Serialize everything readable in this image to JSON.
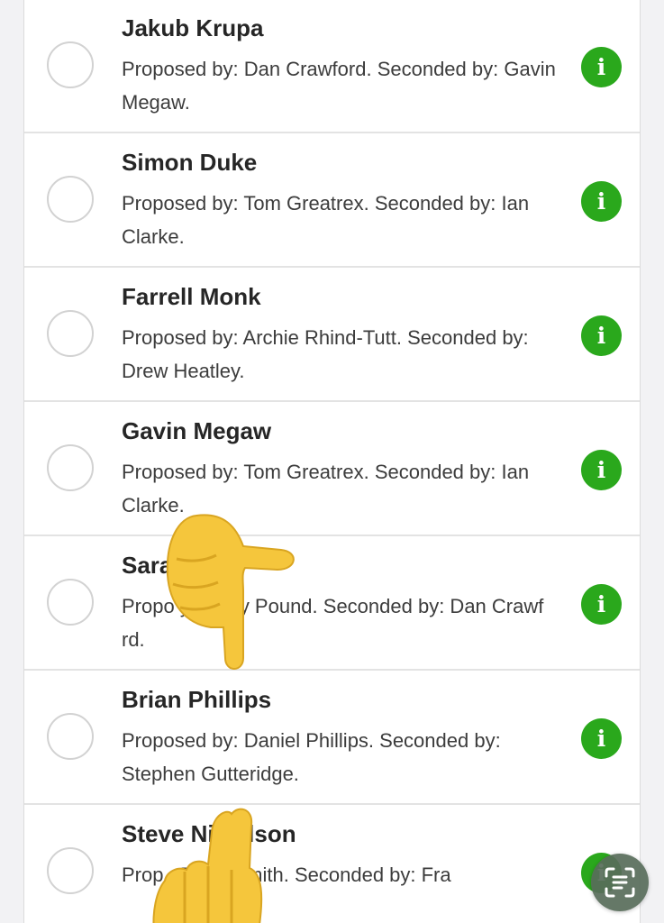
{
  "candidates": [
    {
      "name": "Jakub Krupa",
      "description": "Proposed by: Dan Crawford. Seconded by: Gavin Megaw.",
      "info_glyph": "i"
    },
    {
      "name": "Simon Duke",
      "description": "Proposed by: Tom Greatrex. Seconded by: Ian Clarke.",
      "info_glyph": "i"
    },
    {
      "name": "Farrell Monk",
      "description": "Proposed by: Archie Rhind-Tutt. Seconded by: Drew Heatley.",
      "info_glyph": "i"
    },
    {
      "name": "Gavin Megaw",
      "description": "Proposed by: Tom Greatrex. Seconded by: Ian Clarke.",
      "info_glyph": "i"
    },
    {
      "name": "Sara",
      "description": "Propo y: Emily Pound. Seconded by: Dan Crawf rd.",
      "info_glyph": "i"
    },
    {
      "name": "Brian Phillips",
      "description": "Proposed by: Daniel Phillips. Seconded by: Stephen Gutteridge.",
      "info_glyph": "i"
    },
    {
      "name": "Steve Nic olson",
      "description": "Prop : Peter Smith. Seconded by: Fra",
      "info_glyph": "i"
    }
  ],
  "icons": {
    "radio": "radio-circle-icon",
    "info": "info-icon",
    "scan": "scan-text-icon",
    "pointer_down": "pointing-down-hand-emoji",
    "pointer_up": "pointing-up-hand-emoji"
  },
  "colors": {
    "accent_green": "#2aa81c",
    "background": "#f2f2f4",
    "card": "#ffffff",
    "scan_button": "#586c5a"
  }
}
